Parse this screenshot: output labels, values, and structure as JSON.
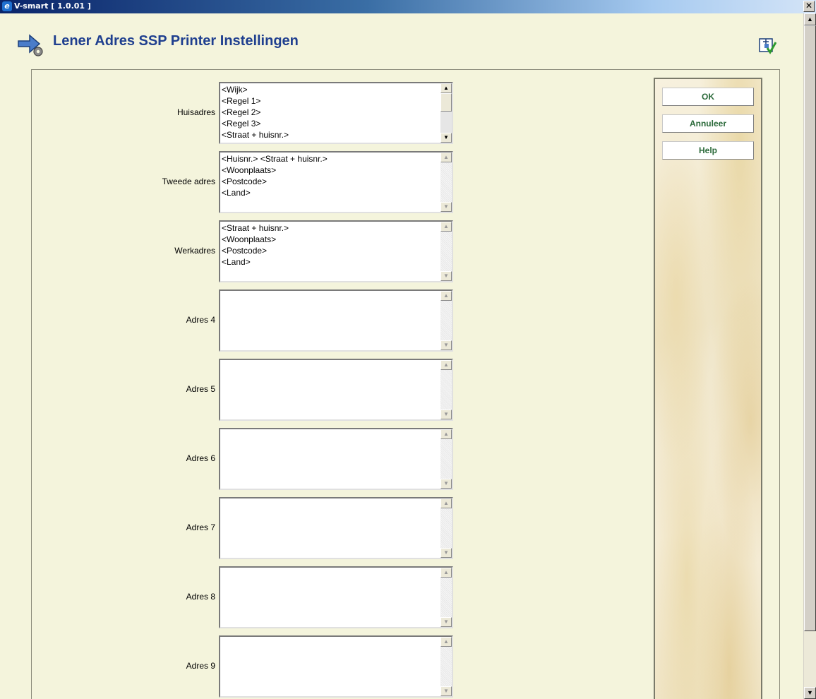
{
  "window": {
    "title": "V-smart [ 1.0.01 ]",
    "close_glyph": "✕"
  },
  "page": {
    "title": "Lener Adres SSP Printer Instellingen"
  },
  "fields": [
    {
      "label": "Huisadres",
      "lines": [
        "<Wijk>",
        "<Regel 1>",
        "<Regel 2>",
        "<Regel 3>",
        "<Straat + huisnr.>"
      ]
    },
    {
      "label": "Tweede adres",
      "lines": [
        "<Huisnr.> <Straat + huisnr.>",
        "<Woonplaats>",
        "<Postcode>",
        "<Land>"
      ]
    },
    {
      "label": "Werkadres",
      "lines": [
        "<Straat + huisnr.>",
        "<Woonplaats>",
        "<Postcode>",
        "<Land>"
      ]
    },
    {
      "label": "Adres 4",
      "lines": []
    },
    {
      "label": "Adres 5",
      "lines": []
    },
    {
      "label": "Adres 6",
      "lines": []
    },
    {
      "label": "Adres 7",
      "lines": []
    },
    {
      "label": "Adres 8",
      "lines": []
    },
    {
      "label": "Adres 9",
      "lines": []
    }
  ],
  "buttons": {
    "ok": "OK",
    "cancel": "Annuleer",
    "help": "Help"
  },
  "scroll": {
    "up_glyph": "▲",
    "down_glyph": "▼"
  }
}
